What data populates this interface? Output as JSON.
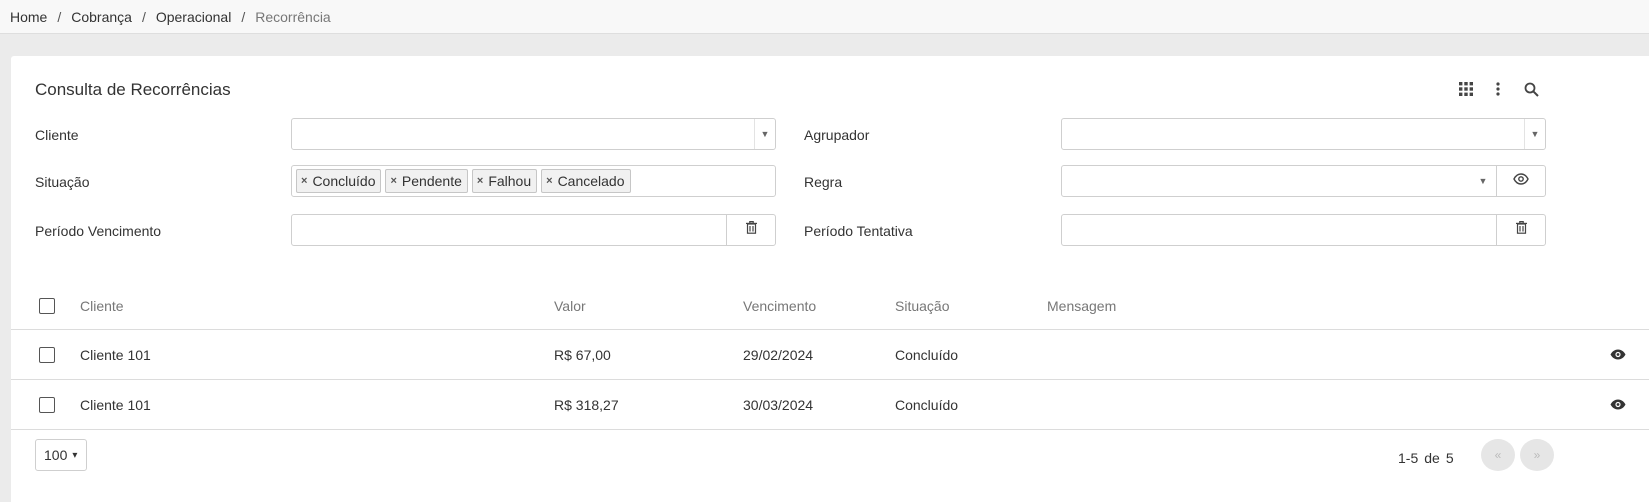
{
  "breadcrumb": [
    "Home",
    "Cobrança",
    "Operacional",
    "Recorrência"
  ],
  "breadcrumb_separator": "/",
  "card": {
    "title": "Consulta de Recorrências",
    "toolbar_icons": [
      "grid-apps-icon",
      "more-vert-icon",
      "search-icon"
    ]
  },
  "filters": {
    "cliente": {
      "label": "Cliente",
      "value": ""
    },
    "agrupador": {
      "label": "Agrupador",
      "value": ""
    },
    "situacao": {
      "label": "Situação",
      "tags": [
        "Concluído",
        "Pendente",
        "Falhou",
        "Cancelado"
      ]
    },
    "regra": {
      "label": "Regra",
      "value": ""
    },
    "periodo_vencimento": {
      "label": "Período Vencimento",
      "value": ""
    },
    "periodo_tentativa": {
      "label": "Período Tentativa",
      "value": ""
    }
  },
  "table": {
    "columns": [
      "Cliente",
      "Valor",
      "Vencimento",
      "Situação",
      "Mensagem"
    ],
    "rows": [
      {
        "cliente": "Cliente 101",
        "valor": "R$ 67,00",
        "vencimento": "29/02/2024",
        "situacao": "Concluído",
        "mensagem": ""
      },
      {
        "cliente": "Cliente 101",
        "valor": "R$ 318,27",
        "vencimento": "30/03/2024",
        "situacao": "Concluído",
        "mensagem": ""
      }
    ]
  },
  "pagination": {
    "page_size": "100",
    "range": "1-5",
    "of_label": "de",
    "total": "5",
    "prev_label": "«",
    "next_label": "»"
  },
  "colors": {
    "background": "#ebebeb",
    "card": "#ffffff",
    "border": "#cfcfcf"
  }
}
